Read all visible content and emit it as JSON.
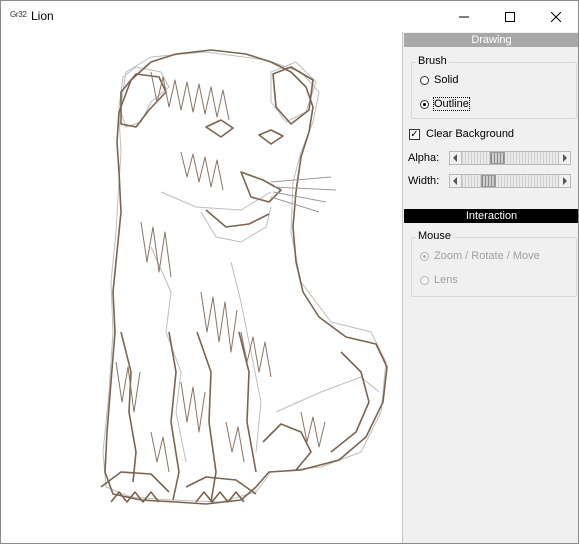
{
  "window": {
    "icon_text": "Gr32",
    "title": "Lion"
  },
  "panel": {
    "drawing_header": "Drawing",
    "brush": {
      "label": "Brush",
      "options": [
        "Solid",
        "Outline"
      ],
      "selected": "Outline"
    },
    "clear_background": {
      "label": "Clear Background",
      "checked": true
    },
    "alpha": {
      "label": "Alpha:",
      "level": 0.35
    },
    "width": {
      "label": "Width:",
      "level": 0.23
    },
    "interaction_header": "Interaction",
    "mouse": {
      "label": "Mouse",
      "options": [
        "Zoom / Rotate / Move",
        "Lens"
      ],
      "selected": "Zoom / Rotate / Move",
      "enabled": false
    }
  },
  "colors": {
    "panel_bg": "#f0f0f0",
    "drawing_header_bg": "#a8a8a8",
    "interaction_header_bg": "#000000",
    "lion_stroke_dark": "#7a6450",
    "lion_stroke_light": "#b8b8b8"
  },
  "icons": [
    "minimize-icon",
    "maximize-icon",
    "close-icon",
    "chevron-left-icon",
    "chevron-right-icon"
  ]
}
